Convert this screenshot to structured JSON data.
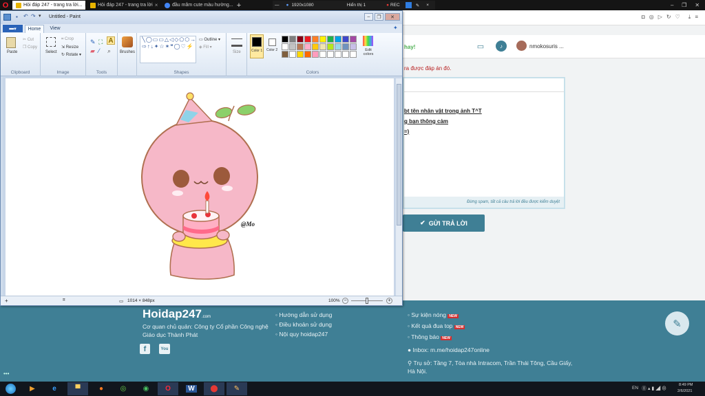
{
  "browser": {
    "tabs": [
      {
        "label": "Hỏi đáp 247 - trang tra lời...",
        "fav": "#e8b400"
      },
      {
        "label": "Hỏi đáp 247 - trang tra lời",
        "fav": "#e8b400"
      },
      {
        "label": "đầu mâm cute màu hường...",
        "fav": "#4285f4"
      }
    ],
    "new_tab": "+",
    "recorder": {
      "resolution": "1920x1080",
      "display": "Hiển thị 1",
      "rec": "REC"
    }
  },
  "site": {
    "nav_hay": "hay!",
    "username": "nmokosuris ...",
    "notice": "ra được đáp án đó.",
    "answer_lines": [
      "bt tên nhân vật trong ảnh T^T",
      "g bạn thông cảm",
      "=)"
    ],
    "spam_note": "Đừng spam, tất cả câu trả lời đều được kiểm duyệt",
    "submit": "GỬI TRẢ LỜI"
  },
  "footer": {
    "logo": "Hoidap247",
    "logo_sub": ".com",
    "owner": "Cơ quan chủ quản: Công ty Cổ phần Công nghệ Giáo dục Thành Phát",
    "col2": [
      "Hướng dẫn sử dụng",
      "Điều khoản sử dụng",
      "Nội quy hoidap247"
    ],
    "col3": [
      "Sự kiện nóng",
      "Kết quả đua top",
      "Thông báo"
    ],
    "new_badge": "NEW",
    "inbox": "Inbox: m.me/hoidap247online",
    "address": "Trụ sở: Tầng 7, Tòa nhà Intracom, Trần Thái Tông, Cầu Giấy, Hà Nội.",
    "fb": "f",
    "yt": "You"
  },
  "paint": {
    "title": "Untitled - Paint",
    "tabs": {
      "file": "▾",
      "home": "Home",
      "view": "View"
    },
    "clipboard": {
      "paste": "Paste",
      "cut": "Cut",
      "copy": "Copy",
      "label": "Clipboard"
    },
    "image": {
      "select": "Select",
      "crop": "Crop",
      "resize": "Resize",
      "rotate": "Rotate",
      "label": "Image"
    },
    "tools": {
      "label": "Tools"
    },
    "brushes": "Brushes",
    "shapes": {
      "outline": "Outline",
      "fill": "Fill",
      "label": "Shapes"
    },
    "size": "Size",
    "color1": "Color 1",
    "color2": "Color 2",
    "edit_colors": "Edit colors",
    "colors_label": "Colors",
    "palette": [
      "#000000",
      "#7f7f7f",
      "#880015",
      "#ed1c24",
      "#ff7f27",
      "#fff200",
      "#22b14c",
      "#00a2e8",
      "#3f48cc",
      "#a349a4",
      "#ffffff",
      "#c3c3c3",
      "#b97a57",
      "#ffaec9",
      "#ffc90e",
      "#efe4b0",
      "#b5e61d",
      "#99d9ea",
      "#7092be",
      "#c8bfe7",
      "#7f5f3f",
      "#ffffff",
      "#ffd800",
      "#ff6a00",
      "#ff9cbd",
      "#ffffff",
      "#ffffff",
      "#ffffff",
      "#ffffff",
      "#ffffff"
    ],
    "signature": "@Mo",
    "status": {
      "dimensions": "1014 × 848px",
      "zoom": "100%"
    }
  },
  "taskbar": {
    "time": "8:49 PM",
    "date": "2/6/2021",
    "lang": "EN"
  }
}
